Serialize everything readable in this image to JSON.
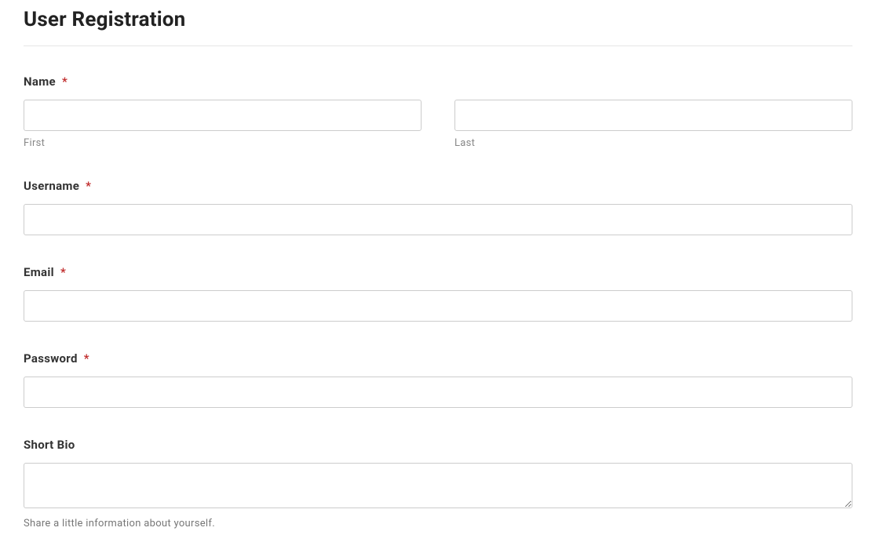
{
  "form": {
    "title": "User Registration",
    "required_marker": "*",
    "fields": {
      "name": {
        "label": "Name",
        "required": true,
        "first": {
          "sub_label": "First",
          "value": ""
        },
        "last": {
          "sub_label": "Last",
          "value": ""
        }
      },
      "username": {
        "label": "Username",
        "required": true,
        "value": ""
      },
      "email": {
        "label": "Email",
        "required": true,
        "value": ""
      },
      "password": {
        "label": "Password",
        "required": true,
        "value": ""
      },
      "short_bio": {
        "label": "Short Bio",
        "required": false,
        "value": "",
        "help": "Share a little information about yourself."
      }
    }
  }
}
